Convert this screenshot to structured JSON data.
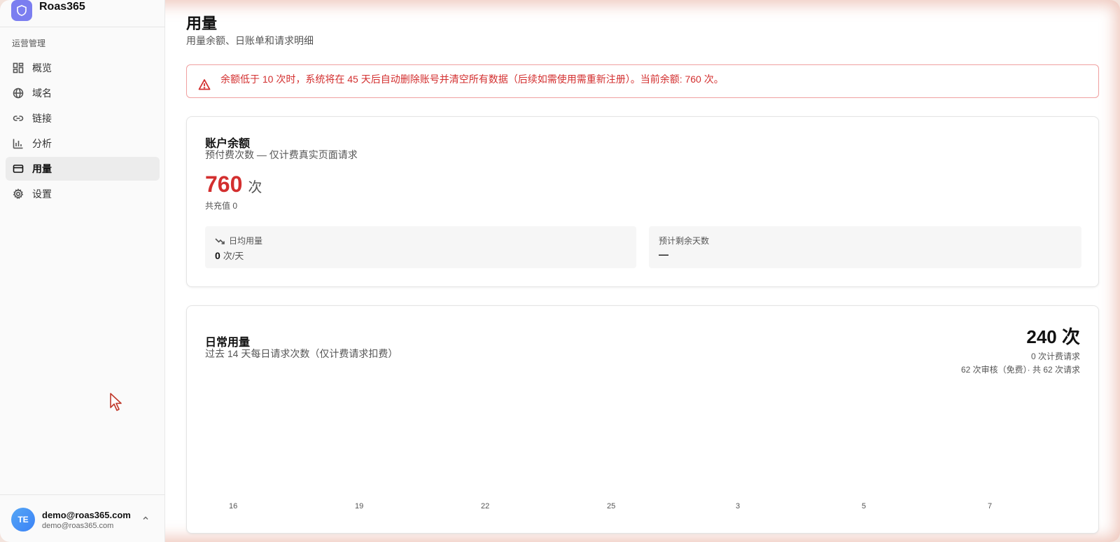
{
  "sidebar": {
    "brand": "Roas365",
    "section_label": "运营管理",
    "items": [
      {
        "label": "概览",
        "icon": "dashboard-icon"
      },
      {
        "label": "域名",
        "icon": "globe-icon"
      },
      {
        "label": "链接",
        "icon": "link-icon"
      },
      {
        "label": "分析",
        "icon": "bar-chart-icon"
      },
      {
        "label": "用量",
        "icon": "credit-card-icon",
        "active": true
      },
      {
        "label": "设置",
        "icon": "gear-icon"
      }
    ],
    "user": {
      "initials": "TE",
      "name": "demo@roas365.com",
      "email": "demo@roas365.com"
    }
  },
  "header": {
    "title": "用量",
    "subtitle": "用量余额、日账单和请求明细"
  },
  "alert": {
    "text": "余额低于 10 次时，系统将在 45 天后自动删除账号并清空所有数据（后续如需使用需重新注册）。当前余额: 760 次。",
    "color": "#d32f2f"
  },
  "balance_card": {
    "title": "账户余额",
    "subtitle": "预付费次数 — 仅计费真实页面请求",
    "balance": "760",
    "unit": "次",
    "recharged": "共充值 0",
    "daily_avg": {
      "label": "日均用量",
      "value": "0",
      "unit": "次/天"
    },
    "days_left": {
      "label": "预计剩余天数",
      "value": "—"
    }
  },
  "usage_card": {
    "title": "日常用量",
    "subtitle": "过去 14 天每日请求次数（仅计费请求扣费）",
    "total": "240 次",
    "billed": "0 次计费请求",
    "detail": "62 次审核（免费）· 共 62 次请求",
    "x_ticks": [
      "16",
      "19",
      "22",
      "25",
      "3",
      "5",
      "7"
    ]
  }
}
